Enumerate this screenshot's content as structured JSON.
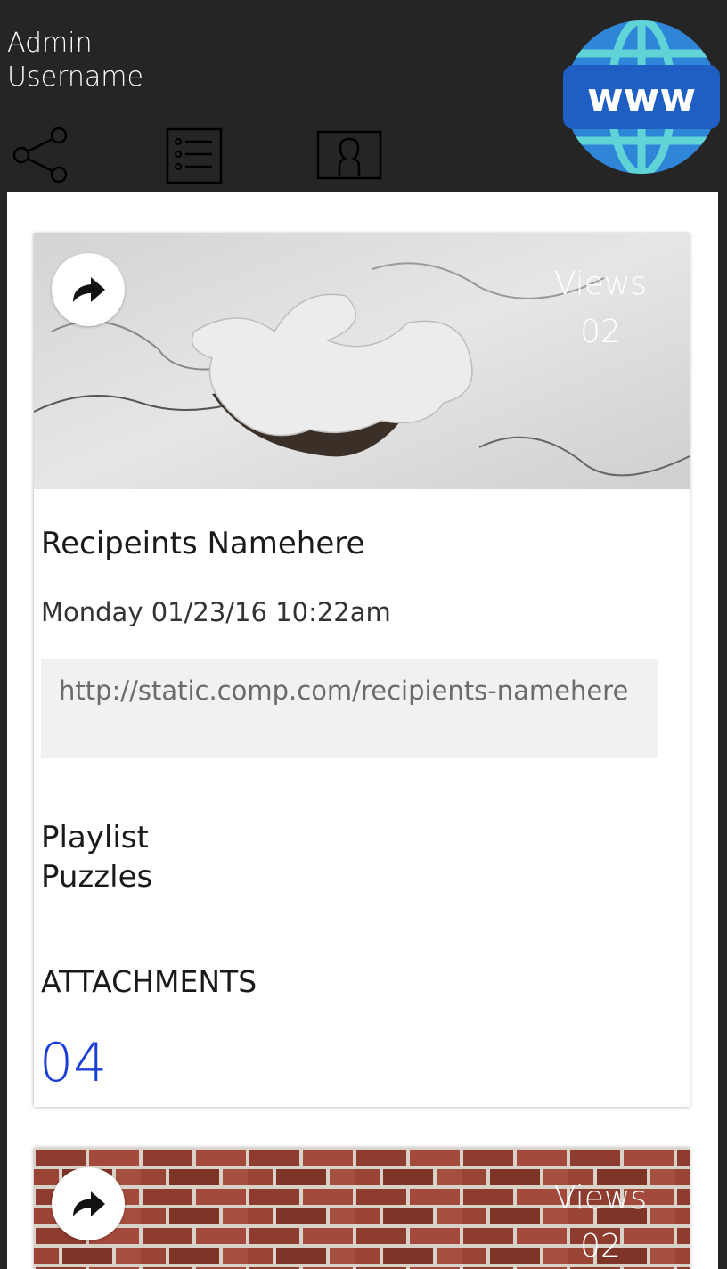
{
  "header": {
    "admin_label": "Admin",
    "username_label": "Username",
    "globe_text": "www",
    "icons": [
      "share-icon",
      "list-icon",
      "contact-card-icon"
    ]
  },
  "cards": [
    {
      "views_label": "Views",
      "views_count": "02",
      "recipient": "Recipeints Namehere",
      "datetime": "Monday 01/23/16 10:22am",
      "url": "http://static.comp.com/recipients-namehere",
      "playlist_label": "Playlist",
      "playlist_name": "Puzzles",
      "attachments_label": "ATTACHMENTS",
      "attachments_count": "04"
    },
    {
      "views_label": "Views",
      "views_count": "02"
    }
  ],
  "colors": {
    "header_bg": "#252525",
    "accent_count": "#1a3fd6",
    "globe_blue": "#1f5fc4",
    "globe_teal": "#5fd3d6"
  }
}
